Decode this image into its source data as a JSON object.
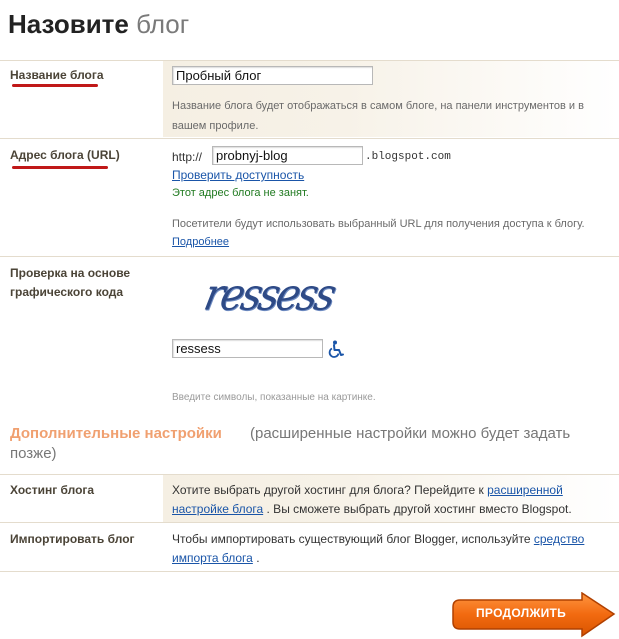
{
  "header": {
    "title_strong": "Назовите",
    "title_light": "блог"
  },
  "blog_name": {
    "label": "Название блога",
    "value": "Пробный блог",
    "hint": "Название блога будет отображаться в самом блоге, на панели инструментов и в вашем профиле."
  },
  "blog_url": {
    "label": "Адрес блога (URL)",
    "prefix": "http://",
    "value": "probnyj-blog",
    "suffix": ".blogspot.com",
    "check_link": "Проверить доступность",
    "status": "Этот адрес блога не занят.",
    "hint": "Посетители будут использовать выбранный URL для получения доступа к блогу.",
    "more_link": "Подробнее"
  },
  "captcha": {
    "label_line1": "Проверка на основе",
    "label_line2": "графического кода",
    "image_text": "ressess",
    "value": "ressess",
    "hint": "Введите символы, показанные на картинке.",
    "accessibility_icon": "wheelchair-icon"
  },
  "advanced": {
    "title": "Дополнительные настройки",
    "subtitle_line1": "(расширенные настройки можно будет задать",
    "subtitle_line2": "позже)"
  },
  "hosting": {
    "label": "Хостинг блога",
    "text_before": "Хотите выбрать другой хостинг для блога? Перейдите к",
    "link_part1": "расширенной",
    "link_part2": "настройке блога",
    "text_after": ". Вы сможете выбрать другой хостинг вместо Blogspot."
  },
  "import": {
    "label": "Импортировать блог",
    "text_before": "Чтобы импортировать существующий блог Blogger, используйте",
    "link_part1": "средство",
    "link_part2": "импорта блога",
    "text_after": "."
  },
  "continue_button": {
    "label": "ПРОДОЛЖИТЬ",
    "icon": "arrow-right-icon"
  },
  "colors": {
    "accent_orange": "#f26a10",
    "link_blue": "#1a55a8",
    "status_green": "#207a20",
    "underline_red": "#c01818"
  }
}
